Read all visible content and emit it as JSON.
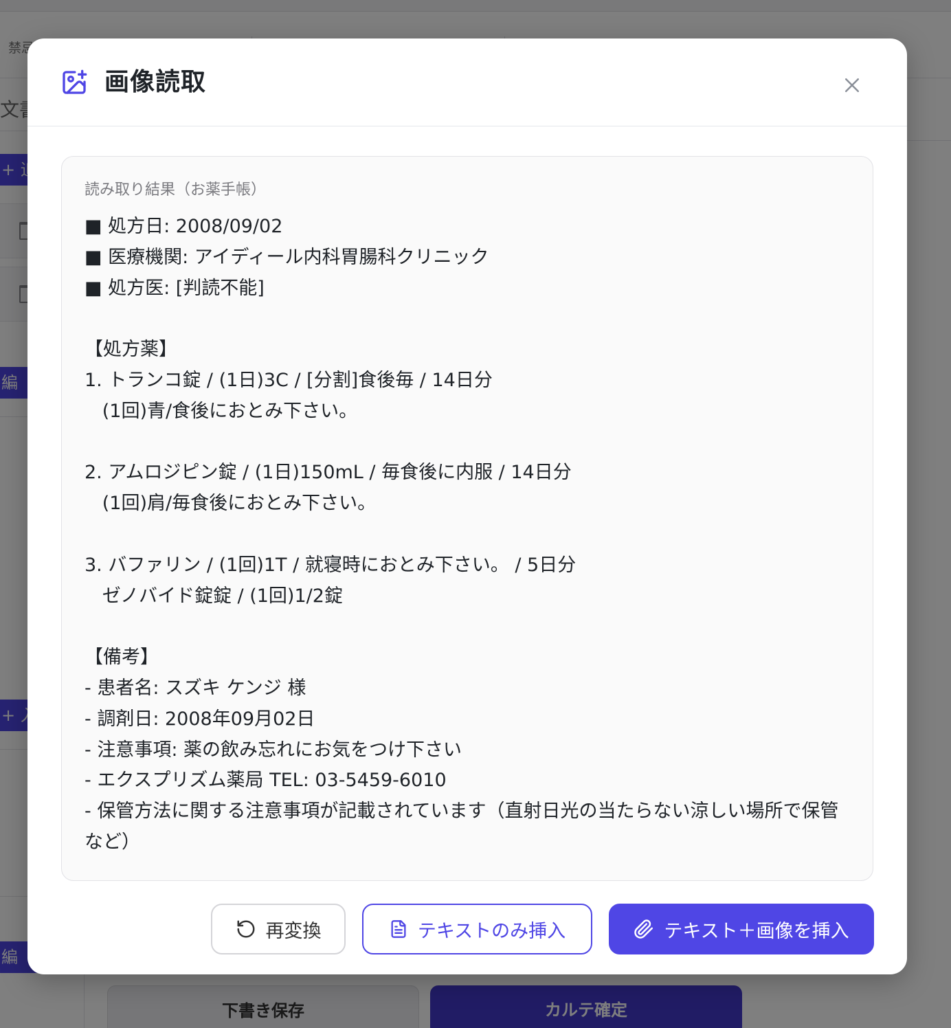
{
  "background": {
    "filter_label": "禁忌",
    "section_label": "文書",
    "add_button_label": "+ 追",
    "edit_button_label": "編",
    "add_button2_label": "+ 入",
    "draft_button_label": "下書き保存",
    "confirm_button_label": "カルテ確定"
  },
  "modal": {
    "title": "画像読取",
    "result_label": "読み取り結果（お薬手帳）",
    "result_text": "■ 処方日: 2008/09/02\n■ 医療機関: アイディール内科胃腸科クリニック\n■ 処方医: [判読不能]\n\n【処方薬】\n1. トランコ錠 / (1日)3C / [分割]食後毎 / 14日分\n   (1回)青/食後におとみ下さい。\n\n2. アムロジピン錠 / (1日)150mL / 毎食後に内服 / 14日分\n   (1回)肩/毎食後におとみ下さい。\n\n3. バファリン / (1回)1T / 就寝時におとみ下さい。 / 5日分\n   ゼノバイド錠錠 / (1回)1/2錠\n\n【備考】\n- 患者名: スズキ ケンジ 様\n- 調剤日: 2008年09月02日\n- 注意事項: 薬の飲み忘れにお気をつけ下さい\n- エクスプリズム薬局 TEL: 03-5459-6010\n- 保管方法に関する注意事項が記載されています（直射日光の当たらない涼しい場所で保管など）",
    "buttons": {
      "reconvert": "再変換",
      "text_only": "テキストのみ挿入",
      "text_and_image": "テキスト＋画像を挿入"
    }
  },
  "colors": {
    "accent": "#4f46e5",
    "overlay": "rgba(0,0,0,0.5)",
    "title_text": "#1f2328",
    "muted_text": "#7b7b80"
  },
  "icons": {
    "header": "image-plus-icon",
    "close": "close-icon",
    "reconvert": "rotate-ccw-icon",
    "text_only": "file-text-icon",
    "text_and_image": "paperclip-icon"
  }
}
